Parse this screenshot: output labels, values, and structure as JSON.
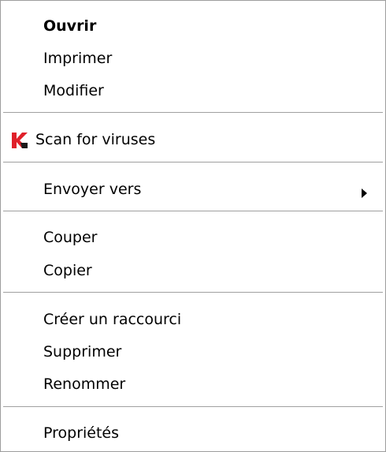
{
  "menu": {
    "items": [
      {
        "label": "Ouvrir"
      },
      {
        "label": "Imprimer"
      },
      {
        "label": "Modifier"
      },
      {
        "label": "Scan for viruses",
        "icon": "kaspersky-icon"
      },
      {
        "label": "Envoyer vers",
        "icon": "submenu-arrow-icon"
      },
      {
        "label": "Couper"
      },
      {
        "label": "Copier"
      },
      {
        "label": "Créer un raccourci"
      },
      {
        "label": "Supprimer"
      },
      {
        "label": "Renommer"
      },
      {
        "label": "Propriétés"
      }
    ]
  },
  "colors": {
    "icon_red": "#e0202a",
    "icon_dark": "#1a1a1a"
  }
}
